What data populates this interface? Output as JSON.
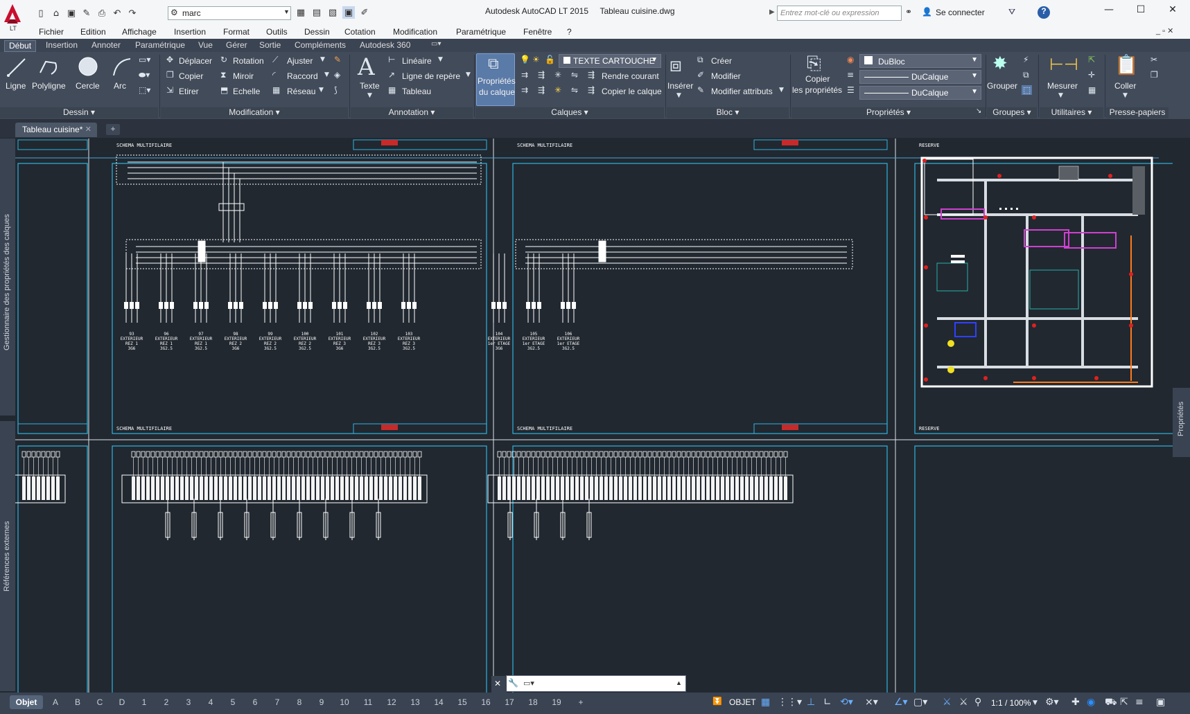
{
  "titlebar": {
    "app_title": "Autodesk AutoCAD LT 2015",
    "file_title": "Tableau cuisine.dwg",
    "workspace": "marc",
    "search_placeholder": "Entrez mot-clé ou expression",
    "login": "Se connecter",
    "app_badge": "LT"
  },
  "menu": [
    "Fichier",
    "Edition",
    "Affichage",
    "Insertion",
    "Format",
    "Outils",
    "Dessin",
    "Cotation",
    "Modification",
    "Paramétrique",
    "Fenêtre",
    "?"
  ],
  "ribbon_tabs": [
    "Début",
    "Insertion",
    "Annoter",
    "Paramétrique",
    "Vue",
    "Gérer",
    "Sortie",
    "Compléments",
    "Autodesk 360"
  ],
  "ribbon": {
    "dessin": {
      "title": "Dessin",
      "ligne": "Ligne",
      "polyligne": "Polyligne",
      "cercle": "Cercle",
      "arc": "Arc"
    },
    "modification": {
      "title": "Modification",
      "deplacer": "Déplacer",
      "rotation": "Rotation",
      "ajuster": "Ajuster",
      "copier": "Copier",
      "miroir": "Miroir",
      "raccord": "Raccord",
      "etirer": "Etirer",
      "echelle": "Echelle",
      "reseau": "Réseau"
    },
    "annotation": {
      "title": "Annotation",
      "texte": "Texte",
      "lineaire": "Linéaire",
      "ligne_repere": "Ligne de repère",
      "tableau": "Tableau"
    },
    "calques": {
      "title": "Calques",
      "proprietes": "Propriétés",
      "du_calque": "du calque",
      "current_layer": "TEXTE CARTOUCHE",
      "rendre_courant": "Rendre courant",
      "copier_calque": "Copier le calque"
    },
    "bloc": {
      "title": "Bloc",
      "inserer": "Insérer",
      "creer": "Créer",
      "modifier": "Modifier",
      "modifier_attributs": "Modifier attributs"
    },
    "proprietes": {
      "title": "Propriétés",
      "copier": "Copier",
      "les_proprietes": "les propriétés",
      "color": "DuBloc",
      "linetype": "DuCalque",
      "lineweight": "DuCalque"
    },
    "groupes": {
      "title": "Groupes",
      "grouper": "Grouper"
    },
    "utilitaires": {
      "title": "Utilitaires",
      "mesurer": "Mesurer"
    },
    "presse_papiers": {
      "title": "Presse-papiers",
      "coller": "Coller"
    }
  },
  "file_tab": "Tableau cuisine*",
  "palettes": {
    "left_top": "Gestionnaire des propriétés des calques",
    "left_bottom": "Références externes",
    "right": "Propriétés"
  },
  "drawing": {
    "schema_label": "SCHEMA MULTIFILAIRE",
    "reserve_label": "RESERVE",
    "circuits_left": [
      {
        "num": "93",
        "line1": "EXTERIEUR",
        "line2": "REZ 1",
        "line3": "3G6"
      },
      {
        "num": "96",
        "line1": "EXTERIEUR",
        "line2": "REZ 1",
        "line3": "3G2.5"
      },
      {
        "num": "97",
        "line1": "EXTERIEUR",
        "line2": "REZ 1",
        "line3": "3G2.5"
      },
      {
        "num": "98",
        "line1": "EXTERIEUR",
        "line2": "REZ 2",
        "line3": "3G6"
      },
      {
        "num": "99",
        "line1": "EXTERIEUR",
        "line2": "REZ 2",
        "line3": "3G2.5"
      },
      {
        "num": "100",
        "line1": "EXTERIEUR",
        "line2": "REZ 2",
        "line3": "3G2.5"
      },
      {
        "num": "101",
        "line1": "EXTERIEUR",
        "line2": "REZ 3",
        "line3": "3G6"
      },
      {
        "num": "102",
        "line1": "EXTERIEUR",
        "line2": "REZ 3",
        "line3": "3G2.5"
      },
      {
        "num": "103",
        "line1": "EXTERIEUR",
        "line2": "REZ 3",
        "line3": "3G2.5"
      }
    ],
    "circuits_right": [
      {
        "num": "104",
        "line1": "EXTERIEUR",
        "line2": "1er ETAGE",
        "line3": "3G6"
      },
      {
        "num": "105",
        "line1": "EXTERIEUR",
        "line2": "1er ETAGE",
        "line3": "3G2.5"
      },
      {
        "num": "106",
        "line1": "EXTERIEUR",
        "line2": "1er ETAGE",
        "line3": "3G2.5"
      }
    ]
  },
  "layout_tabs": [
    "Objet",
    "A",
    "B",
    "C",
    "D",
    "1",
    "2",
    "3",
    "4",
    "5",
    "6",
    "7",
    "8",
    "9",
    "10",
    "11",
    "12",
    "13",
    "14",
    "15",
    "16",
    "17",
    "18",
    "19"
  ],
  "status": {
    "mode": "OBJET",
    "scale": "1:1 / 100%"
  }
}
